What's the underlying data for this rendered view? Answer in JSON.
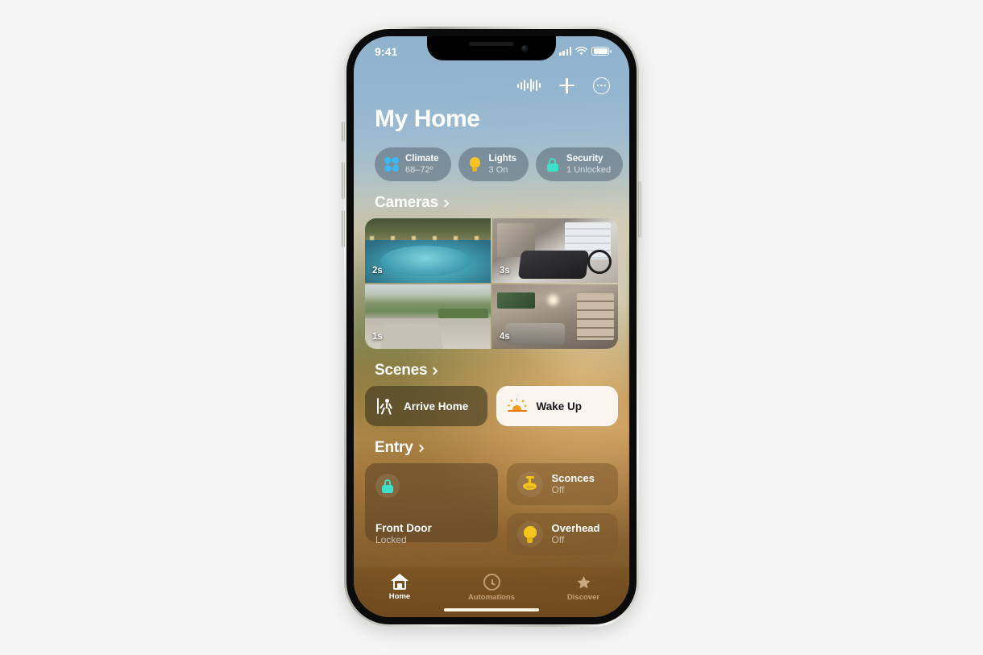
{
  "app": {
    "name": "Home",
    "page_title": "My Home"
  },
  "status_bar": {
    "time": "9:41",
    "signal_icon": "cellular-bars-icon",
    "wifi_icon": "wifi-icon",
    "battery_icon": "battery-icon"
  },
  "nav_actions": [
    {
      "name": "siri-waveform-icon",
      "label": "Siri"
    },
    {
      "name": "add-icon",
      "label": "Add"
    },
    {
      "name": "more-icon",
      "label": "More"
    }
  ],
  "status_chips": [
    {
      "title": "Climate",
      "subtitle": "68–72º",
      "icon": "fan-icon",
      "accent": "#3bb8f5"
    },
    {
      "title": "Lights",
      "subtitle": "3 On",
      "icon": "lightbulb-icon",
      "accent": "#f7c325"
    },
    {
      "title": "Security",
      "subtitle": "1 Unlocked",
      "icon": "lock-icon",
      "accent": "#3ee0c8"
    }
  ],
  "sections": {
    "cameras": {
      "title": "Cameras",
      "chevron": "chevron-right-icon",
      "tiles": [
        {
          "badge": "2s",
          "scene": "pool-backyard"
        },
        {
          "badge": "3s",
          "scene": "garage-gym"
        },
        {
          "badge": "1s",
          "scene": "driveway-street"
        },
        {
          "badge": "4s",
          "scene": "living-room"
        }
      ]
    },
    "scenes": {
      "title": "Scenes",
      "chevron": "chevron-right-icon",
      "tiles": [
        {
          "label": "Arrive Home",
          "icon": "walking-person-icon",
          "style": "dark"
        },
        {
          "label": "Wake Up",
          "icon": "sunrise-icon",
          "style": "light"
        }
      ]
    },
    "entry": {
      "title": "Entry",
      "chevron": "chevron-right-icon",
      "door": {
        "name": "Front Door",
        "status": "Locked",
        "icon": "lock-icon"
      },
      "lights": [
        {
          "name": "Sconces",
          "status": "Off",
          "icon": "sconce-icon"
        },
        {
          "name": "Overhead",
          "status": "Off",
          "icon": "lightbulb-icon"
        }
      ]
    }
  },
  "tab_bar": [
    {
      "label": "Home",
      "icon": "home-icon",
      "active": true
    },
    {
      "label": "Automations",
      "icon": "clock-icon",
      "active": false
    },
    {
      "label": "Discover",
      "icon": "star-icon",
      "active": false
    }
  ],
  "colors": {
    "page_background": "#f5f5f5",
    "sky": "#8fb2cd",
    "warm": "#a2763c",
    "accent_cyan": "#3ee0c8",
    "accent_yellow": "#f5c61d",
    "accent_blue": "#3bb8f5",
    "scene_light_bg": "#faf6ef"
  }
}
